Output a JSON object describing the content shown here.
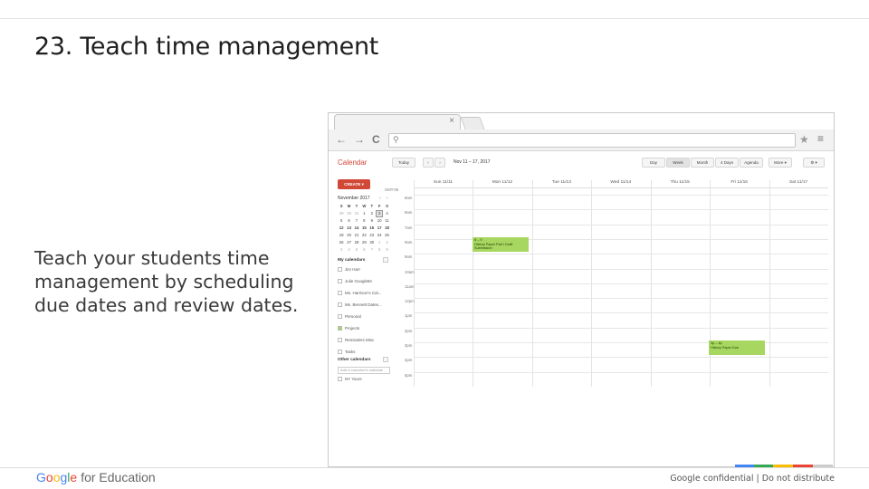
{
  "slide": {
    "title": "23. Teach time management",
    "body": "Teach your students time management by scheduling due dates and review dates.",
    "footer_brand_g": "G",
    "footer_brand_o1": "o",
    "footer_brand_o2": "o",
    "footer_brand_g2": "g",
    "footer_brand_l": "l",
    "footer_brand_e": "e",
    "footer_edu": "for Education",
    "footer_note": "Google confidential | Do not distribute",
    "colors": {
      "blue": "#4285f4",
      "green": "#34a853",
      "yellow": "#fbbc05",
      "red": "#ea4335",
      "gray": "#cccccc"
    }
  },
  "browser": {
    "tab_close": "×",
    "nav_back": "←",
    "nav_forward": "→",
    "nav_reload": "C",
    "omni_search_icon": "🔍",
    "star_icon": "★",
    "menu_icon": "≡"
  },
  "calendar": {
    "brand": "Calendar",
    "today_button": "Today",
    "prev": "‹",
    "next": "›",
    "range": "Nov 11 – 17, 2017",
    "view_buttons": [
      "Day",
      "Week",
      "Month",
      "4 Days",
      "Agenda"
    ],
    "more_button": "More ▾",
    "settings_button": "⚙ ▾",
    "create_button": "CREATE ▾",
    "minical": {
      "title": "November 2017",
      "prev": "‹",
      "next": "›",
      "weekday_letters": [
        "S",
        "M",
        "T",
        "W",
        "T",
        "F",
        "S"
      ],
      "weeks": [
        [
          "29",
          "30",
          "31",
          "1",
          "2",
          "3",
          "4"
        ],
        [
          "5",
          "6",
          "7",
          "8",
          "9",
          "10",
          "11"
        ],
        [
          "12",
          "13",
          "14",
          "15",
          "16",
          "17",
          "18"
        ],
        [
          "19",
          "20",
          "21",
          "22",
          "23",
          "24",
          "25"
        ],
        [
          "26",
          "27",
          "28",
          "29",
          "30",
          "1",
          "2"
        ],
        [
          "3",
          "4",
          "5",
          "6",
          "7",
          "8",
          "9"
        ]
      ]
    },
    "my_calendars": {
      "label": "My calendars",
      "items": [
        "Jim Harr",
        "Julie Googlette",
        "Ms. Harrison's Cal...",
        "Ms. Bennett Dates...",
        "Personal",
        "Projects",
        "Reminders Misc",
        "Tasks"
      ]
    },
    "other_calendars": {
      "label": "Other calendars",
      "add_placeholder": "Add a coworker's calendar",
      "items": [
        "NY Yours"
      ]
    },
    "timezone": "GMT-05",
    "days": [
      "Sun 11/11",
      "Mon 11/12",
      "Tue 11/13",
      "Wed 11/14",
      "Thu 11/15",
      "Fri 11/16",
      "Sat 11/17"
    ],
    "times": [
      "8am",
      "9am",
      "7am",
      "9am",
      "9am",
      "10am",
      "11am",
      "12pm",
      "1pm",
      "2pm",
      "3pm",
      "4pm",
      "5pm"
    ],
    "events": [
      {
        "time": "8 – 9",
        "title": "History Paper Part I Draft Submission"
      },
      {
        "time": "3p – 4p",
        "title": "History Paper Due"
      }
    ]
  }
}
